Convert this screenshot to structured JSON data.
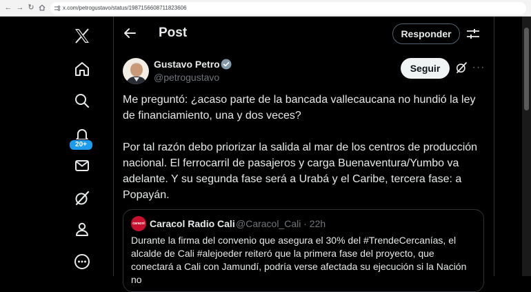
{
  "browser": {
    "url": "x.com/petrogustavo/status/1987156608711823606"
  },
  "sidebar": {
    "items": [
      {
        "icon": "x-logo-icon"
      },
      {
        "icon": "home-icon"
      },
      {
        "icon": "search-icon"
      },
      {
        "icon": "notifications-icon",
        "badge": "20+"
      },
      {
        "icon": "messages-icon"
      },
      {
        "icon": "grok-icon"
      },
      {
        "icon": "profile-icon"
      },
      {
        "icon": "more-icon"
      }
    ]
  },
  "header": {
    "title": "Post",
    "reply_label": "Responder"
  },
  "post": {
    "author_name": "Gustavo Petro",
    "handle": "@petrogustavo",
    "follow_label": "Seguir",
    "paragraphs": [
      "Me preguntó: ¿acaso parte de la bancada vallecaucana no hundió la ley de financiamiento, una y dos veces?",
      "Por tal razón debo priorizar la salida al mar de los centros de producción nacional. El ferrocarril de pasajeros y carga Buenaventura/Yumbo va adelante. Y su segunda fase será a Urabá y el Caribe, tercera fase: a Popayán."
    ]
  },
  "quote": {
    "avatar_text": "caracol",
    "name": "Caracol Radio Cali",
    "meta": "@Caracol_Cali · 22h",
    "text": "Durante la firma del convenio que asegura el 30% del #TrendeCercanías, el alcalde de Cali #alejoeder reiteró que la primera fase del proyecto, que conectará a Cali con Jamundí, podría verse afectada su ejecución si la Nación no"
  },
  "colors": {
    "accent": "#1d9bf0",
    "background": "#000000",
    "text": "#e7e9ea",
    "muted": "#71767b"
  }
}
